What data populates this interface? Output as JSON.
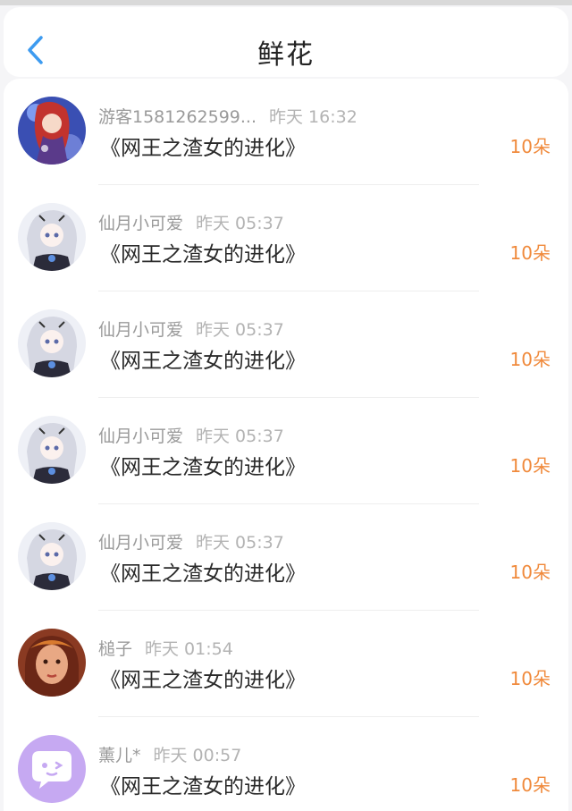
{
  "header": {
    "title": "鲜花",
    "back_icon": "chevron-left-icon"
  },
  "colors": {
    "accent_back": "#3d9bf0",
    "count": "#f08a3c",
    "name": "#9a9a9a",
    "book": "#2a2a2a"
  },
  "items": [
    {
      "name": "游客1581262599...",
      "time": "昨天 16:32",
      "book": "《网王之渣女的进化》",
      "count": "10朵",
      "avatar": "avatar-anime-red"
    },
    {
      "name": "仙月小可爱",
      "time": "昨天 05:37",
      "book": "《网王之渣女的进化》",
      "count": "10朵",
      "avatar": "avatar-anime-silver"
    },
    {
      "name": "仙月小可爱",
      "time": "昨天 05:37",
      "book": "《网王之渣女的进化》",
      "count": "10朵",
      "avatar": "avatar-anime-silver"
    },
    {
      "name": "仙月小可爱",
      "time": "昨天 05:37",
      "book": "《网王之渣女的进化》",
      "count": "10朵",
      "avatar": "avatar-anime-silver"
    },
    {
      "name": "仙月小可爱",
      "time": "昨天 05:37",
      "book": "《网王之渣女的进化》",
      "count": "10朵",
      "avatar": "avatar-anime-silver"
    },
    {
      "name": "槌子",
      "time": "昨天 01:54",
      "book": "《网王之渣女的进化》",
      "count": "10朵",
      "avatar": "avatar-illustrated-woman"
    },
    {
      "name": "薰儿*",
      "time": "昨天 00:57",
      "book": "《网王之渣女的进化》",
      "count": "10朵",
      "avatar": "avatar-chat-bubble"
    }
  ]
}
